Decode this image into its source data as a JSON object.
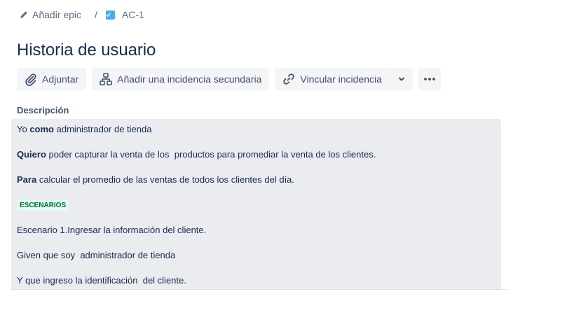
{
  "breadcrumb": {
    "epic_label": "Añadir epic",
    "separator": "/",
    "issue_key": "AC-1"
  },
  "title": "Historia de usuario",
  "toolbar": {
    "attach": "Adjuntar",
    "add_child": "Añadir una incidencia secundaria",
    "link_issue": "Vincular incidencia"
  },
  "description": {
    "label": "Descripción",
    "lines": [
      {
        "prefix": "Yo ",
        "bold": "como",
        "rest": " administrador de tienda"
      },
      {
        "prefix": "",
        "bold": "Quiero",
        "rest": " poder capturar la venta de los  productos para promediar la venta de los clientes."
      },
      {
        "prefix": "",
        "bold": "Para",
        "rest": " calcular el promedio de las ventas de todos los clientes del día."
      }
    ],
    "lozenge": "ESCENARIOS",
    "plain_lines": [
      "Escenario 1.Ingresar la información del cliente.",
      "Given que soy  administrador de tienda",
      "Y que ingreso la identificación  del cliente."
    ]
  },
  "colors": {
    "text": "#172b4d",
    "subtle": "#42526e",
    "button_bg": "#f4f5f7",
    "desc_bg": "#ebecf0",
    "task_icon": "#4bade8",
    "lozenge_bg": "#e3fcef",
    "lozenge_text": "#006644"
  },
  "icons": {
    "epic": "pencil-icon",
    "issue_type": "task-checkbox-icon",
    "attach": "paperclip-icon",
    "add_child": "hierarchy-icon",
    "link": "link-chain-icon",
    "dropdown": "chevron-down-icon",
    "more": "ellipsis-icon"
  }
}
